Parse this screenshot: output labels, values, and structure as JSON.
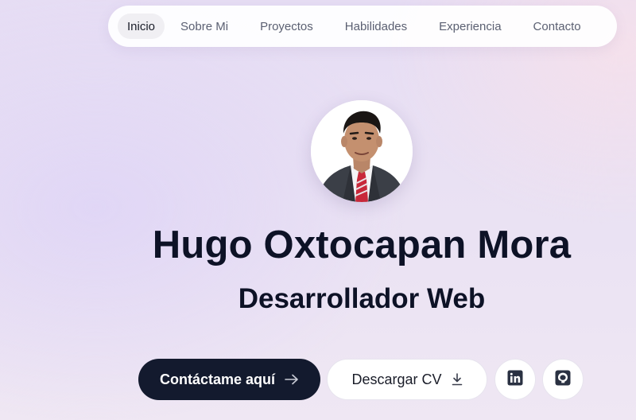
{
  "nav": {
    "items": [
      {
        "label": "Inicio",
        "active": true
      },
      {
        "label": "Sobre Mi",
        "active": false
      },
      {
        "label": "Proyectos",
        "active": false
      },
      {
        "label": "Habilidades",
        "active": false
      },
      {
        "label": "Experiencia",
        "active": false
      },
      {
        "label": "Contacto",
        "active": false
      }
    ]
  },
  "hero": {
    "avatar_icon": "profile-photo",
    "name": "Hugo Oxtocapan Mora",
    "role": "Desarrollador Web"
  },
  "actions": {
    "contact_label": "Contáctame aquí",
    "contact_icon": "arrow-right-icon",
    "cv_label": "Descargar CV",
    "cv_icon": "download-icon",
    "linkedin_icon": "linkedin-icon",
    "github_icon": "github-icon"
  },
  "colors": {
    "primary_dark": "#131a2e",
    "heading": "#0d1226",
    "nav_active_bg": "#f0eff3",
    "nav_text": "#5b6072"
  }
}
